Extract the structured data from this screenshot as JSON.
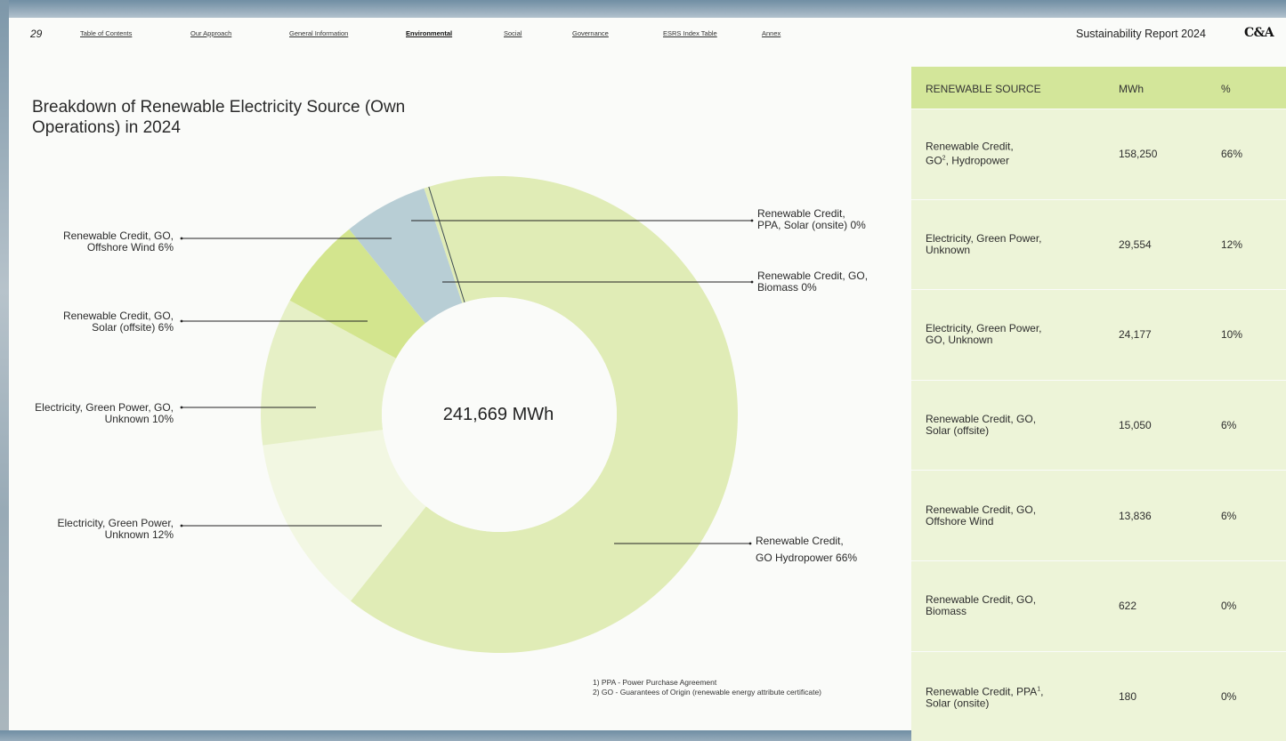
{
  "page_number": "29",
  "nav": [
    {
      "label": "Table of Contents",
      "active": false
    },
    {
      "label": "Our Approach",
      "active": false
    },
    {
      "label": "General Information",
      "active": false
    },
    {
      "label": "Environmental",
      "active": true
    },
    {
      "label": "Social",
      "active": false
    },
    {
      "label": "Governance",
      "active": false
    },
    {
      "label": "ESRS Index Table",
      "active": false
    },
    {
      "label": "Annex",
      "active": false
    }
  ],
  "report_title": "Sustainability Report 2024",
  "logo_text": "C&A",
  "chart_data": {
    "type": "pie",
    "title": "Breakdown of Renewable Electricity Source (Own Operations) in 2024",
    "center_label": "241,669 MWh",
    "slices": [
      {
        "label": "Renewable Credit, GO Hydropower",
        "value": 158250,
        "percent_label": "66%",
        "color": "#e0ecb6"
      },
      {
        "label": "Electricity, Green Power, Unknown",
        "value": 29554,
        "percent_label": "12%",
        "color": "#f2f7e2"
      },
      {
        "label": "Electricity, Green Power, GO, Unknown",
        "value": 24177,
        "percent_label": "10%",
        "color": "#e6f0c6"
      },
      {
        "label": "Renewable Credit, GO, Solar (offsite)",
        "value": 15050,
        "percent_label": "6%",
        "color": "#d3e58e"
      },
      {
        "label": "Renewable Credit, GO, Offshore Wind",
        "value": 13836,
        "percent_label": "6%",
        "color": "#b8ced5"
      },
      {
        "label": "Renewable Credit, GO, Biomass",
        "value": 622,
        "percent_label": "0%",
        "color": "#e0ecb6"
      },
      {
        "label": "Renewable Credit, PPA, Solar (onsite)",
        "value": 180,
        "percent_label": "0%",
        "color": "#e0ecb6"
      }
    ],
    "callouts": [
      {
        "line1": "Renewable Credit,",
        "line2": "PPA, Solar (onsite) 0%",
        "side": "right"
      },
      {
        "line1": "Renewable Credit, GO,",
        "line2": "Biomass 0%",
        "side": "right"
      },
      {
        "line1": "Renewable Credit,",
        "line2": "GO Hydropower 66%",
        "side": "right"
      },
      {
        "line1": "Renewable Credit, GO,",
        "line2": "Offshore Wind 6%",
        "side": "left"
      },
      {
        "line1": "Renewable Credit, GO,",
        "line2": "Solar (offsite) 6%",
        "side": "left"
      },
      {
        "line1": "Electricity, Green Power, GO,",
        "line2": "Unknown 10%",
        "side": "left"
      },
      {
        "line1": "Electricity, Green Power,",
        "line2": "Unknown 12%",
        "side": "left"
      }
    ]
  },
  "footnotes": [
    "1) PPA - Power Purchase Agreement",
    "2) GO - Guarantees of Origin (renewable energy attribute certificate)"
  ],
  "table": {
    "headers": [
      "RENEWABLE SOURCE",
      "MWh",
      "%"
    ],
    "header_color": "#d3e69a",
    "row_color": "#edf4d8",
    "rows": [
      {
        "source_line1": "Renewable Credit,",
        "source_line2": "GO",
        "sup": "2",
        "source_line2_rest": ", Hydropower",
        "mwh": "158,250",
        "pct": "66%"
      },
      {
        "source_line1": "Electricity, Green Power,",
        "source_line2": "Unknown",
        "sup": "",
        "source_line2_rest": "",
        "mwh": "29,554",
        "pct": "12%"
      },
      {
        "source_line1": "Electricity, Green Power,",
        "source_line2": "GO, Unknown",
        "sup": "",
        "source_line2_rest": "",
        "mwh": "24,177",
        "pct": "10%"
      },
      {
        "source_line1": "Renewable Credit, GO,",
        "source_line2": "Solar (offsite)",
        "sup": "",
        "source_line2_rest": "",
        "mwh": "15,050",
        "pct": "6%"
      },
      {
        "source_line1": "Renewable Credit, GO,",
        "source_line2": "Offshore Wind",
        "sup": "",
        "source_line2_rest": "",
        "mwh": "13,836",
        "pct": "6%"
      },
      {
        "source_line1": "Renewable Credit, GO,",
        "source_line2": "Biomass",
        "sup": "",
        "source_line2_rest": "",
        "mwh": "622",
        "pct": "0%"
      },
      {
        "source_line1": "Renewable Credit, PPA",
        "source_line1_sup": "1",
        "source_line1_rest": ",",
        "source_line2": "Solar (onsite)",
        "sup": "",
        "source_line2_rest": "",
        "mwh": "180",
        "pct": "0%"
      }
    ]
  }
}
